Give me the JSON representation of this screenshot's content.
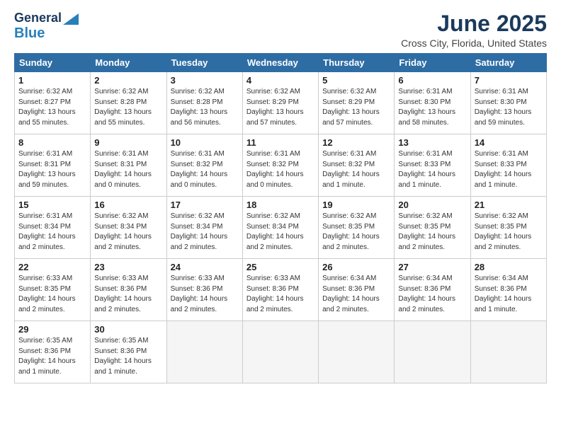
{
  "header": {
    "logo_line1": "General",
    "logo_line2": "Blue",
    "month": "June 2025",
    "location": "Cross City, Florida, United States"
  },
  "days_of_week": [
    "Sunday",
    "Monday",
    "Tuesday",
    "Wednesday",
    "Thursday",
    "Friday",
    "Saturday"
  ],
  "weeks": [
    [
      {
        "num": "1",
        "info": "Sunrise: 6:32 AM\nSunset: 8:27 PM\nDaylight: 13 hours\nand 55 minutes."
      },
      {
        "num": "2",
        "info": "Sunrise: 6:32 AM\nSunset: 8:28 PM\nDaylight: 13 hours\nand 55 minutes."
      },
      {
        "num": "3",
        "info": "Sunrise: 6:32 AM\nSunset: 8:28 PM\nDaylight: 13 hours\nand 56 minutes."
      },
      {
        "num": "4",
        "info": "Sunrise: 6:32 AM\nSunset: 8:29 PM\nDaylight: 13 hours\nand 57 minutes."
      },
      {
        "num": "5",
        "info": "Sunrise: 6:32 AM\nSunset: 8:29 PM\nDaylight: 13 hours\nand 57 minutes."
      },
      {
        "num": "6",
        "info": "Sunrise: 6:31 AM\nSunset: 8:30 PM\nDaylight: 13 hours\nand 58 minutes."
      },
      {
        "num": "7",
        "info": "Sunrise: 6:31 AM\nSunset: 8:30 PM\nDaylight: 13 hours\nand 59 minutes."
      }
    ],
    [
      {
        "num": "8",
        "info": "Sunrise: 6:31 AM\nSunset: 8:31 PM\nDaylight: 13 hours\nand 59 minutes."
      },
      {
        "num": "9",
        "info": "Sunrise: 6:31 AM\nSunset: 8:31 PM\nDaylight: 14 hours\nand 0 minutes."
      },
      {
        "num": "10",
        "info": "Sunrise: 6:31 AM\nSunset: 8:32 PM\nDaylight: 14 hours\nand 0 minutes."
      },
      {
        "num": "11",
        "info": "Sunrise: 6:31 AM\nSunset: 8:32 PM\nDaylight: 14 hours\nand 0 minutes."
      },
      {
        "num": "12",
        "info": "Sunrise: 6:31 AM\nSunset: 8:32 PM\nDaylight: 14 hours\nand 1 minute."
      },
      {
        "num": "13",
        "info": "Sunrise: 6:31 AM\nSunset: 8:33 PM\nDaylight: 14 hours\nand 1 minute."
      },
      {
        "num": "14",
        "info": "Sunrise: 6:31 AM\nSunset: 8:33 PM\nDaylight: 14 hours\nand 1 minute."
      }
    ],
    [
      {
        "num": "15",
        "info": "Sunrise: 6:31 AM\nSunset: 8:34 PM\nDaylight: 14 hours\nand 2 minutes."
      },
      {
        "num": "16",
        "info": "Sunrise: 6:32 AM\nSunset: 8:34 PM\nDaylight: 14 hours\nand 2 minutes."
      },
      {
        "num": "17",
        "info": "Sunrise: 6:32 AM\nSunset: 8:34 PM\nDaylight: 14 hours\nand 2 minutes."
      },
      {
        "num": "18",
        "info": "Sunrise: 6:32 AM\nSunset: 8:34 PM\nDaylight: 14 hours\nand 2 minutes."
      },
      {
        "num": "19",
        "info": "Sunrise: 6:32 AM\nSunset: 8:35 PM\nDaylight: 14 hours\nand 2 minutes."
      },
      {
        "num": "20",
        "info": "Sunrise: 6:32 AM\nSunset: 8:35 PM\nDaylight: 14 hours\nand 2 minutes."
      },
      {
        "num": "21",
        "info": "Sunrise: 6:32 AM\nSunset: 8:35 PM\nDaylight: 14 hours\nand 2 minutes."
      }
    ],
    [
      {
        "num": "22",
        "info": "Sunrise: 6:33 AM\nSunset: 8:35 PM\nDaylight: 14 hours\nand 2 minutes."
      },
      {
        "num": "23",
        "info": "Sunrise: 6:33 AM\nSunset: 8:36 PM\nDaylight: 14 hours\nand 2 minutes."
      },
      {
        "num": "24",
        "info": "Sunrise: 6:33 AM\nSunset: 8:36 PM\nDaylight: 14 hours\nand 2 minutes."
      },
      {
        "num": "25",
        "info": "Sunrise: 6:33 AM\nSunset: 8:36 PM\nDaylight: 14 hours\nand 2 minutes."
      },
      {
        "num": "26",
        "info": "Sunrise: 6:34 AM\nSunset: 8:36 PM\nDaylight: 14 hours\nand 2 minutes."
      },
      {
        "num": "27",
        "info": "Sunrise: 6:34 AM\nSunset: 8:36 PM\nDaylight: 14 hours\nand 2 minutes."
      },
      {
        "num": "28",
        "info": "Sunrise: 6:34 AM\nSunset: 8:36 PM\nDaylight: 14 hours\nand 1 minute."
      }
    ],
    [
      {
        "num": "29",
        "info": "Sunrise: 6:35 AM\nSunset: 8:36 PM\nDaylight: 14 hours\nand 1 minute."
      },
      {
        "num": "30",
        "info": "Sunrise: 6:35 AM\nSunset: 8:36 PM\nDaylight: 14 hours\nand 1 minute."
      },
      {
        "num": "",
        "info": ""
      },
      {
        "num": "",
        "info": ""
      },
      {
        "num": "",
        "info": ""
      },
      {
        "num": "",
        "info": ""
      },
      {
        "num": "",
        "info": ""
      }
    ]
  ]
}
